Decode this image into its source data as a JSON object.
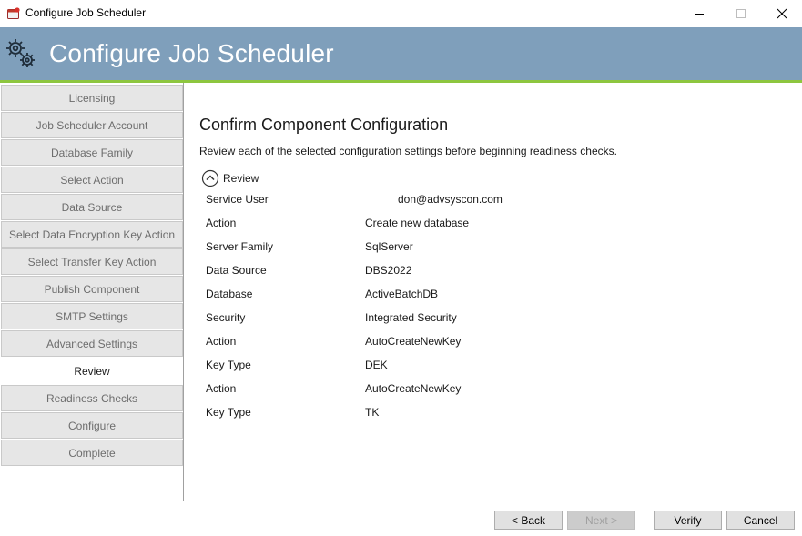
{
  "window": {
    "title": "Configure Job Scheduler"
  },
  "banner": {
    "title": "Configure Job Scheduler"
  },
  "sidebar": {
    "items": [
      {
        "label": "Licensing",
        "active": false
      },
      {
        "label": "Job Scheduler Account",
        "active": false
      },
      {
        "label": "Database Family",
        "active": false
      },
      {
        "label": "Select Action",
        "active": false
      },
      {
        "label": "Data Source",
        "active": false
      },
      {
        "label": "Select Data Encryption Key Action",
        "active": false
      },
      {
        "label": "Select Transfer Key Action",
        "active": false
      },
      {
        "label": "Publish Component",
        "active": false
      },
      {
        "label": "SMTP Settings",
        "active": false
      },
      {
        "label": "Advanced Settings",
        "active": false
      },
      {
        "label": "Review",
        "active": true
      },
      {
        "label": "Readiness Checks",
        "active": false
      },
      {
        "label": "Configure",
        "active": false
      },
      {
        "label": "Complete",
        "active": false
      }
    ]
  },
  "main": {
    "title": "Confirm Component Configuration",
    "description": "Review each of the selected configuration settings before beginning readiness checks.",
    "review_label": "Review",
    "rows": [
      {
        "label": "Service User",
        "value": "don@advsyscon.com"
      },
      {
        "label": "Action",
        "value": "Create new database"
      },
      {
        "label": "Server Family",
        "value": "SqlServer"
      },
      {
        "label": "Data Source",
        "value": "DBS2022"
      },
      {
        "label": "Database",
        "value": "ActiveBatchDB"
      },
      {
        "label": "Security",
        "value": "Integrated Security"
      },
      {
        "label": "Action",
        "value": "AutoCreateNewKey"
      },
      {
        "label": "Key Type",
        "value": "DEK"
      },
      {
        "label": "Action",
        "value": "AutoCreateNewKey"
      },
      {
        "label": "Key Type",
        "value": "TK"
      }
    ]
  },
  "footer": {
    "back_label": "< Back",
    "next_label": "Next >",
    "verify_label": "Verify",
    "cancel_label": "Cancel"
  },
  "colors": {
    "banner": "#7f9fbb",
    "banner_accent": "#8dc63f",
    "nav_inactive_bg": "#e6e6e6",
    "nav_inactive_text": "#6d6d6d"
  },
  "icons": {
    "app": "app-icon",
    "banner": "gears-icon",
    "review_toggle": "chevron-up-circle-icon"
  }
}
